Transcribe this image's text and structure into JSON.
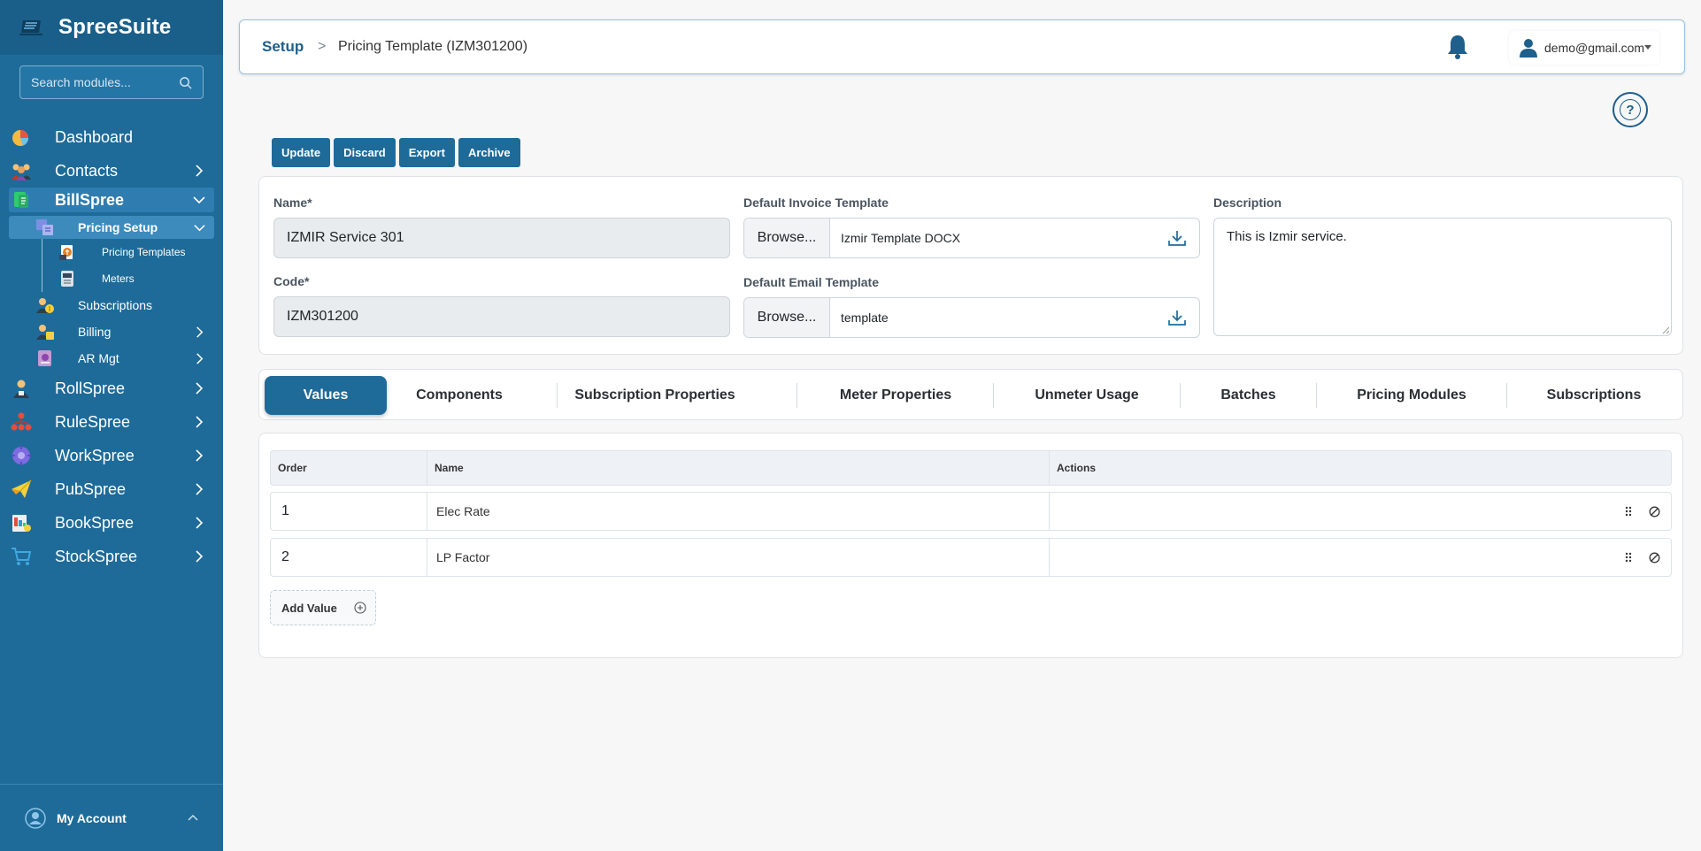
{
  "app": {
    "name": "SpreeSuite"
  },
  "sidebar": {
    "search_placeholder": "Search modules...",
    "items": [
      {
        "label": "Dashboard"
      },
      {
        "label": "Contacts"
      },
      {
        "label": "BillSpree"
      },
      {
        "label": "RollSpree"
      },
      {
        "label": "RuleSpree"
      },
      {
        "label": "WorkSpree"
      },
      {
        "label": "PubSpree"
      },
      {
        "label": "BookSpree"
      },
      {
        "label": "StockSpree"
      }
    ],
    "billspree_children": {
      "pricing_setup": "Pricing Setup",
      "pricing_templates": "Pricing Templates",
      "meters": "Meters",
      "subscriptions": "Subscriptions",
      "billing": "Billing",
      "ar_mgt": "AR Mgt"
    },
    "account_label": "My Account"
  },
  "header": {
    "breadcrumb_root": "Setup",
    "breadcrumb_separator": ">",
    "breadcrumb_page": "Pricing Template (IZM301200)",
    "user_email": "demo@gmail.com",
    "help_symbol": "?"
  },
  "toolbar": {
    "update": "Update",
    "discard": "Discard",
    "export": "Export",
    "archive": "Archive"
  },
  "form": {
    "name_label": "Name*",
    "name_value": "IZMIR Service 301",
    "code_label": "Code*",
    "code_value": "IZM301200",
    "invoice_template_label": "Default Invoice Template",
    "invoice_browse": "Browse...",
    "invoice_file": "Izmir Template DOCX",
    "email_template_label": "Default Email Template",
    "email_browse": "Browse...",
    "email_file": "template",
    "description_label": "Description",
    "description_value": "This is Izmir service."
  },
  "tabs": [
    {
      "label": "Values"
    },
    {
      "label": "Components"
    },
    {
      "label": "Subscription Properties"
    },
    {
      "label": "Meter Properties"
    },
    {
      "label": "Unmeter Usage"
    },
    {
      "label": "Batches"
    },
    {
      "label": "Pricing Modules"
    },
    {
      "label": "Subscriptions"
    }
  ],
  "values_table": {
    "columns": [
      "Order",
      "Name",
      "Actions"
    ],
    "rows": [
      {
        "order": "1",
        "name": "Elec Rate"
      },
      {
        "order": "2",
        "name": "LP Factor"
      }
    ],
    "add_label": "Add Value"
  },
  "colors": {
    "sidebar_bg": "#1e6b99",
    "accent": "#1e6b99",
    "breadcrumb": "#1e5f8c"
  }
}
